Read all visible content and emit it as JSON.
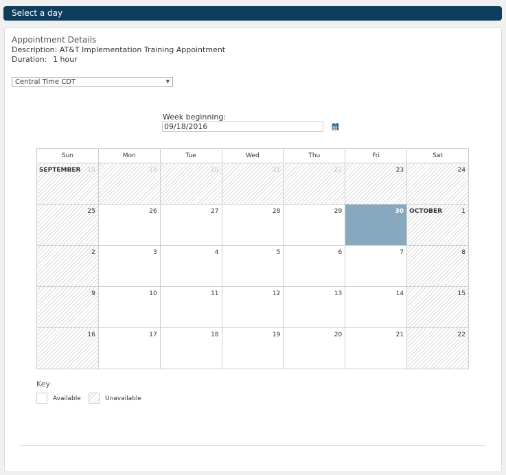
{
  "header": {
    "title": "Select a day"
  },
  "appointment": {
    "heading": "Appointment Details",
    "description_label": "Description:",
    "description_value": "AT&T Implementation Training Appointment",
    "duration_label": "Duration:",
    "duration_value": "1 hour"
  },
  "timezone": {
    "selected": "Central Time CDT"
  },
  "week": {
    "label": "Week beginning:",
    "value": "09/18/2016"
  },
  "calendar": {
    "days": [
      "Sun",
      "Mon",
      "Tue",
      "Wed",
      "Thu",
      "Fri",
      "Sat"
    ],
    "weeks": [
      [
        {
          "day": "18",
          "month": "SEPTEMBER",
          "status": "unavailable",
          "faded": true
        },
        {
          "day": "19",
          "status": "unavailable",
          "faded": true
        },
        {
          "day": "20",
          "status": "unavailable",
          "faded": true
        },
        {
          "day": "21",
          "status": "unavailable",
          "faded": true
        },
        {
          "day": "22",
          "status": "unavailable",
          "faded": true
        },
        {
          "day": "23",
          "status": "unavailable"
        },
        {
          "day": "24",
          "status": "unavailable"
        }
      ],
      [
        {
          "day": "25",
          "status": "unavailable"
        },
        {
          "day": "26",
          "status": "available"
        },
        {
          "day": "27",
          "status": "available"
        },
        {
          "day": "28",
          "status": "available"
        },
        {
          "day": "29",
          "status": "available"
        },
        {
          "day": "30",
          "status": "selected"
        },
        {
          "day": "1",
          "month": "OCTOBER",
          "status": "unavailable"
        }
      ],
      [
        {
          "day": "2",
          "status": "unavailable"
        },
        {
          "day": "3",
          "status": "available"
        },
        {
          "day": "4",
          "status": "available"
        },
        {
          "day": "5",
          "status": "available"
        },
        {
          "day": "6",
          "status": "available"
        },
        {
          "day": "7",
          "status": "available"
        },
        {
          "day": "8",
          "status": "unavailable"
        }
      ],
      [
        {
          "day": "9",
          "status": "unavailable"
        },
        {
          "day": "10",
          "status": "available"
        },
        {
          "day": "11",
          "status": "available"
        },
        {
          "day": "12",
          "status": "available"
        },
        {
          "day": "13",
          "status": "available"
        },
        {
          "day": "14",
          "status": "available"
        },
        {
          "day": "15",
          "status": "unavailable"
        }
      ],
      [
        {
          "day": "16",
          "status": "unavailable"
        },
        {
          "day": "17",
          "status": "available"
        },
        {
          "day": "18",
          "status": "available"
        },
        {
          "day": "19",
          "status": "available"
        },
        {
          "day": "20",
          "status": "available"
        },
        {
          "day": "21",
          "status": "available"
        },
        {
          "day": "22",
          "status": "unavailable"
        }
      ]
    ]
  },
  "key": {
    "title": "Key",
    "available_label": "Available",
    "unavailable_label": "Unavailable"
  },
  "colors": {
    "header_bg": "#0f3d5c",
    "selected_day": "#87a8bf"
  },
  "icons": {
    "calendar_picker": "calendar-icon",
    "dropdown": "chevron-down-icon"
  }
}
